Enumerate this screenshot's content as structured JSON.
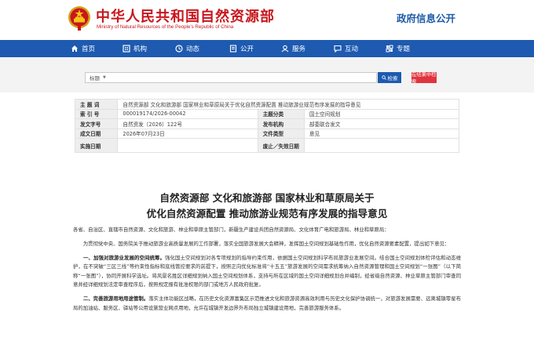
{
  "header": {
    "site_title": "中华人民共和国自然资源部",
    "site_subtitle": "Ministry of Natural Resources of the People’s Republic of China",
    "gov_info_public": "政府信息公开",
    "emblem_icon": "national-emblem-icon",
    "brand_red": "#c8161d",
    "brand_blue": "#1d5ab0"
  },
  "nav": {
    "items": [
      {
        "label": "首页",
        "icon": "home-icon"
      },
      {
        "label": "机构",
        "icon": "org-icon"
      },
      {
        "label": "动态",
        "icon": "news-icon"
      },
      {
        "label": "公开",
        "icon": "open-icon"
      },
      {
        "label": "服务",
        "icon": "service-icon"
      },
      {
        "label": "互动",
        "icon": "chat-icon"
      },
      {
        "label": "专题",
        "icon": "topic-icon"
      }
    ]
  },
  "search": {
    "scope": "标题",
    "placeholder": "",
    "search_button": "检索",
    "search_within_button": "在结果中检索"
  },
  "meta": {
    "labels": {
      "subject": "主  题  词",
      "index_no": "索  引  号",
      "issuer": "发文字号",
      "date": "成文日期",
      "effective": "实施日期",
      "category": "主题分类",
      "issuing_org": "发布机构",
      "doc_type": "文件类型",
      "valid_flag": "废止／失效日期"
    },
    "values": {
      "subject": "自然资源部 文化和旅游部 国家林业和草原局关于优化自然资源配置 推动旅游业规范有序发展的指导意见",
      "index_no": "000019174/2026-00042",
      "issuer": "自然资发〔2026〕122号",
      "date": "2026年07月23日",
      "effective": "",
      "category": "国土空间规划",
      "issuing_org": "部委联合发文",
      "doc_type": "意见",
      "valid_flag": ""
    }
  },
  "document": {
    "title_line1": "自然资源部 文化和旅游部 国家林业和草原局关于",
    "title_line2": "优化自然资源配置 推动旅游业规范有序发展的指导意见",
    "recipients": "各省、自治区、直辖市自然资源、文化和旅游、林业和草原主管部门，新疆生产建设兵团自然资源局、文化体育广电和旅游局、林业和草原局：",
    "intro": "为贯彻党中央、国务院关于推动旅游业高质量发展的工作部署，落实全国旅游发展大会精神，发挥国土空间规划基础性作用，优化自然资源要素配置，提出如下意见：",
    "section1_heading": "一、加强对旅游业发展的空间统筹。",
    "section1_body": "强化国土空间规划对各专项规划的指导约束作用，依据国土空间规划科学布局旅游业发展空间。结合国土空间规划体检评估和动态维护，在不突破“三区三线”等约束性指标和底线管控要求的前提下，按照正向优化标准将“十五五”旅游发展的空间需求统筹纳入自然资源管理和国土空间规划“一张图”（以下简称“一张图”），协同开展科学选址。将风景名胜区详细规划纳入国土空间规划体系，支持与所在区域的国土空间详细规划合并编制，经省级自然资源、林业草原主管部门审查同意并经详细规划法定审查程序后，按照规定报有批准权限的部门或地方人民政府批复。",
    "section2_heading": "二、完善旅游用地用途管制。",
    "section2_body": "落实主体功能区战略，在历史文化资源富集区示范推进文化和旅游资源高效利用与历史文化保护协调统一，对旅游发展需要、远离城镇零星布局的加油站、服务区、驿站等公用设施营业网点用地，允许在城镇开发边界外布局独立城镇建设用地，完善旅游服务体系。"
  }
}
